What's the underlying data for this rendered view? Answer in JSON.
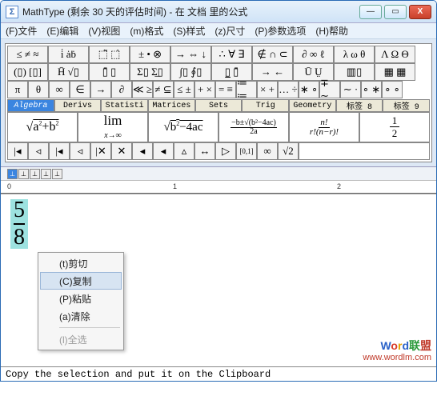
{
  "window": {
    "icon": "Σ",
    "title": "MathType (剩余 30 天的评估时间) - 在 文档 里的公式",
    "min": "—",
    "max": "▭",
    "close": "X"
  },
  "menu": {
    "file": "(F)文件",
    "edit": "(E)编辑",
    "view": "(V)视图",
    "format": "(m)格式",
    "style": "(S)样式",
    "size": "(z)尺寸",
    "prefs": "(P)参数选项",
    "help": "(H)帮助"
  },
  "row1": [
    "≤ ≠ ≈",
    "i̇ ȧḃ",
    "⬚̃ ⬚̇",
    "± • ⊗",
    "→ ⇔ ↓",
    "∴ ∀ ∃",
    "∉ ∩ ⊂",
    "∂ ∞ ℓ",
    "λ ω θ",
    "Λ Ω Θ"
  ],
  "row2": [
    "(▯) [▯]",
    "H̄ √▯",
    "▯̄ ▯",
    "Σ▯ Σ̲▯",
    "∫▯ ∮▯",
    "▯̲ ▯̄",
    "→ ←",
    "Ū Ṳ",
    "▥▯",
    "▦ ▦"
  ],
  "row3": [
    "π",
    "θ",
    "∞",
    "∈",
    "→",
    "∂",
    "≪ ≥",
    "≠ ⊆",
    "≤ ±",
    "+ ×",
    "= ≡",
    "≔ ≔",
    "× +",
    "… ÷",
    "∗ ∘",
    "∓ ∼",
    "∼ ·",
    "∘ ∗",
    "∘ ∘"
  ],
  "tabs": [
    "Algebra",
    "Derivs",
    "Statisti",
    "Matrices",
    "Sets",
    "Trig",
    "Geometry",
    "标签 8",
    "标签 9"
  ],
  "bigcells": {
    "c0": "√(a²+b²)",
    "c1_top": "lim",
    "c1_bot": "x→∞",
    "c2": "√(b²−4ac)",
    "c3_top": "−b±√(b²−4ac)",
    "c3_bot": "2a",
    "c4_top": "n!",
    "c4_bot": "r!(n−r)!",
    "c5_top": "1",
    "c5_bot": "2"
  },
  "row5": [
    "|◂",
    "◃",
    "|◂",
    "◃",
    "|✕",
    "✕",
    "◂",
    "◂",
    "▵",
    "↔",
    "▷",
    "[0,1]",
    "∞",
    "√2"
  ],
  "ruler": {
    "marks": [
      "0",
      "1",
      "2"
    ]
  },
  "fraction": {
    "num": "5",
    "den": "8"
  },
  "context": {
    "cut": "(t)剪切",
    "copy": "(C)复制",
    "paste": "(P)粘贴",
    "clear": "(a)清除",
    "selectall": "(l)全选"
  },
  "status": "Copy the selection and put it on the Clipboard",
  "watermark": {
    "brand_chars": [
      "W",
      "o",
      "r",
      "d",
      "联",
      "盟"
    ],
    "url": "www.wordlm.com"
  }
}
